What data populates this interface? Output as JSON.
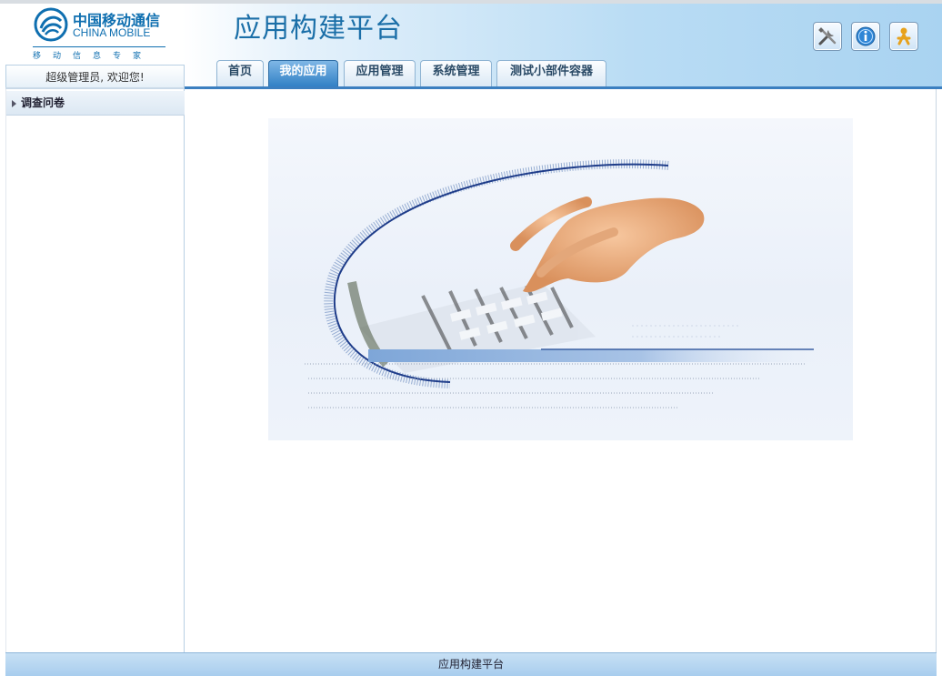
{
  "brand": {
    "logo_cn": "中国移动通信",
    "logo_en": "CHINA MOBILE",
    "slogan": "移动信息专家"
  },
  "header": {
    "app_title": "应用构建平台",
    "welcome": "超级管理员, 欢迎您!",
    "toolbar": [
      {
        "name": "settings-icon"
      },
      {
        "name": "help-icon"
      },
      {
        "name": "user-icon"
      }
    ]
  },
  "tabs": [
    {
      "label": "首页",
      "active": false
    },
    {
      "label": "我的应用",
      "active": true
    },
    {
      "label": "应用管理",
      "active": false
    },
    {
      "label": "系统管理",
      "active": false
    },
    {
      "label": "测试小部件容器",
      "active": false
    }
  ],
  "sidebar": {
    "items": [
      {
        "label": "调查问卷"
      }
    ]
  },
  "banner": {
    "image": "hand-typing-on-keyboard"
  },
  "footer": {
    "text": "应用构建平台"
  },
  "colors": {
    "brand_blue": "#1b6fa8",
    "tab_active": "#2f7fc4",
    "header_gradient_end": "#a9d3f1"
  }
}
